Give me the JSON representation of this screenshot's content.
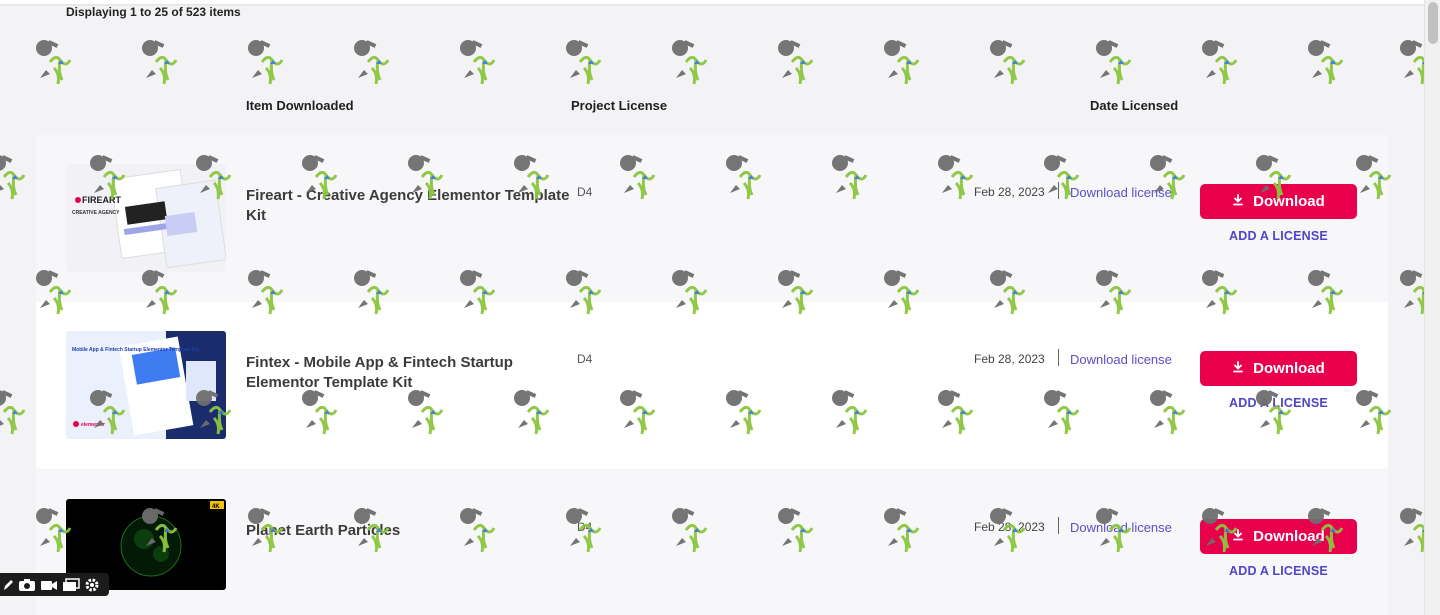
{
  "summary": {
    "count_text": "Displaying 1 to 25 of 523 items"
  },
  "columns": {
    "item": "Item Downloaded",
    "license": "Project License",
    "date": "Date Licensed"
  },
  "items": [
    {
      "title": "Fireart - Creative Agency Elementor Template Kit",
      "license": "D4",
      "date": "Feb 28, 2023",
      "download_license": "Download license",
      "download_button": "Download",
      "add_license": "ADD A LICENSE",
      "thumb_text": "FIREART",
      "thumb_subtext": "CREATIVE AGENCY"
    },
    {
      "title": "Fintex - Mobile App & Fintech Startup Elementor Template Kit",
      "license": "D4",
      "date": "Feb 28, 2023",
      "download_license": "Download license",
      "download_button": "Download",
      "add_license": "ADD A LICENSE",
      "thumb_text": "Mobile App & Fintech Startup Elementor Template Kit",
      "thumb_subtext": "elementor"
    },
    {
      "title": "Planet Earth Particles",
      "license": "D4",
      "date": "Feb 28, 2023",
      "download_license": "Download license",
      "download_button": "Download",
      "add_license": "ADD A LICENSE",
      "thumb_text": "4K"
    }
  ],
  "colors": {
    "accent": "#e8004c",
    "link": "#5b4fc7",
    "add_license": "#4f45c6",
    "watermark_green": "#8cc63f",
    "watermark_gray": "#6e6e6e"
  },
  "icons": {
    "download": "download-icon",
    "toolbar": [
      "pen-icon",
      "camera-icon",
      "video-icon",
      "windows-icon",
      "gear-icon"
    ]
  }
}
